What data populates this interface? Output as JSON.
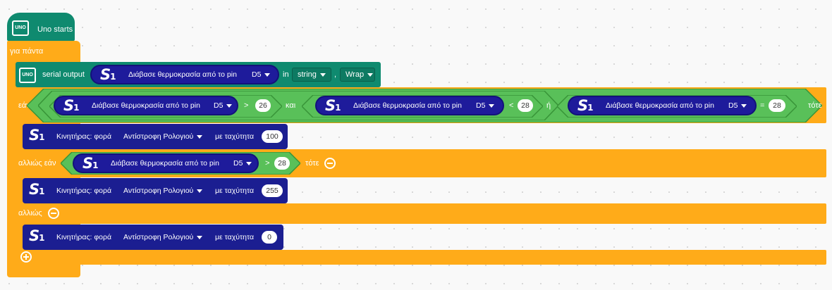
{
  "hat": {
    "label": "Uno starts",
    "icon": "uno-board-icon",
    "icon_text": "UNO"
  },
  "forever": {
    "label": "για πάντα"
  },
  "serial": {
    "label": "serial output",
    "read_label": "Διάβασε θερμοκρασία από το pin",
    "pin": "D5",
    "in_label": "in",
    "format": "string",
    "comma": ",",
    "wrap": "Wrap"
  },
  "if_block": {
    "label": "εάν",
    "then": "τότε",
    "cond1": {
      "read": "Διάβασε θερμοκρασία από το pin",
      "pin": "D5",
      "op": ">",
      "value": "26"
    },
    "and_label": "και",
    "cond2": {
      "read": "Διάβασε θερμοκρασία από το pin",
      "pin": "D5",
      "op": "<",
      "value": "28"
    },
    "or_label": "ή",
    "cond3": {
      "read": "Διάβασε θερμοκρασία από το pin",
      "pin": "D5",
      "op": "=",
      "value": "28"
    },
    "motor": {
      "label": "Κινητήρας: φορά",
      "direction": "Αντίστροφη Ρολογιού",
      "speed_label": "με ταχύτητα",
      "speed": "100"
    }
  },
  "elseif_block": {
    "label": "αλλιώς εάν",
    "then": "τότε",
    "cond": {
      "read": "Διάβασε θερμοκρασία από το pin",
      "pin": "D5",
      "op": ">",
      "value": "28"
    },
    "motor": {
      "label": "Κινητήρας: φορά",
      "direction": "Αντίστροφη Ρολογιού",
      "speed_label": "με ταχύτητα",
      "speed": "255"
    }
  },
  "else_block": {
    "label": "αλλιώς",
    "motor": {
      "label": "Κινητήρας: φορά",
      "direction": "Αντίστροφη Ρολογιού",
      "speed_label": "με ταχύτητα",
      "speed": "0"
    }
  },
  "s1_badge": {
    "text": "S",
    "sub": "1"
  },
  "colors": {
    "control": "#ffab19",
    "logic": "#59c059",
    "sensor": "#1e1b9b",
    "uno": "#0f8a6f"
  }
}
